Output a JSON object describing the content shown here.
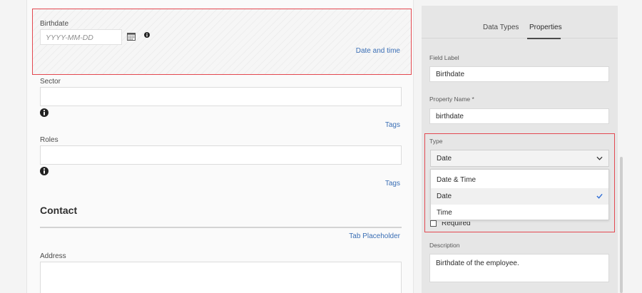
{
  "form": {
    "birthdate": {
      "label": "Birthdate",
      "placeholder": "YYYY-MM-DD",
      "type_link": "Date and time"
    },
    "sector": {
      "label": "Sector",
      "type_link": "Tags"
    },
    "roles": {
      "label": "Roles",
      "type_link": "Tags"
    },
    "contact": {
      "title": "Contact",
      "tab_link": "Tab Placeholder"
    },
    "address": {
      "label": "Address"
    }
  },
  "panel": {
    "tabs": [
      {
        "label": "Data Types",
        "active": false
      },
      {
        "label": "Properties",
        "active": true
      }
    ],
    "field_label": {
      "label": "Field Label",
      "value": "Birthdate"
    },
    "property_name": {
      "label": "Property Name *",
      "value": "birthdate"
    },
    "type": {
      "label": "Type",
      "selected": "Date",
      "options": [
        "Date & Time",
        "Date",
        "Time"
      ]
    },
    "required_label": "Required",
    "description": {
      "label": "Description",
      "value": "Birthdate of the employee."
    }
  },
  "colors": {
    "highlight_border": "#e34850",
    "link": "#3b6fb5",
    "panel_bg": "#e6e6e6",
    "check": "#2d6cd6"
  },
  "icons": [
    "calendar-icon",
    "info-icon",
    "chevron-down-icon",
    "check-icon"
  ]
}
